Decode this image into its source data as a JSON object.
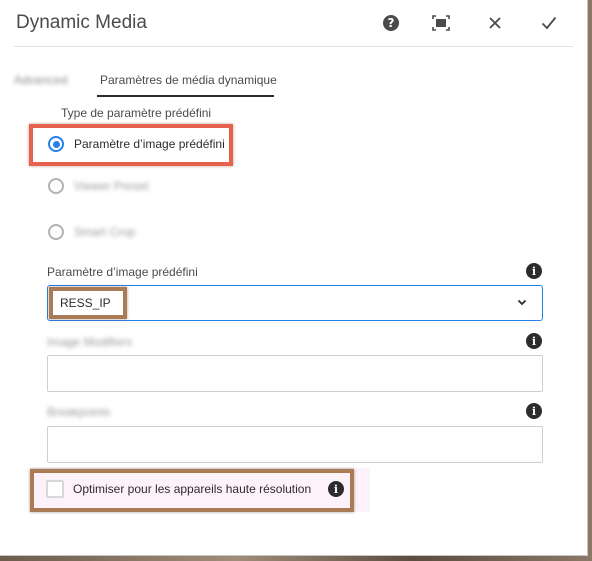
{
  "dialog": {
    "title": "Dynamic Media",
    "actions": {
      "help": "?",
      "fullscreen": "fullscreen",
      "close": "close",
      "done": "done"
    }
  },
  "tabs": [
    {
      "label": "Advanced",
      "active": false,
      "obscured": true
    },
    {
      "label": "Paramètres de média dynamique",
      "active": true
    }
  ],
  "preset_type": {
    "label": "Type de paramètre prédéfini",
    "options": [
      {
        "label": "Paramètre d’image prédéfini",
        "selected": true
      },
      {
        "label": "Viewer Preset",
        "selected": false,
        "obscured": true
      },
      {
        "label": "Smart Crop",
        "selected": false,
        "obscured": true
      }
    ]
  },
  "image_preset": {
    "label": "Paramètre d’image prédéfini",
    "value": "RESS_IP"
  },
  "image_modifiers": {
    "label": "Image Modifiers",
    "value": "",
    "obscured": true
  },
  "breakpoints": {
    "label": "Breakpoints",
    "value": "",
    "obscured": true
  },
  "hires_option": {
    "label": "Optimiser pour les appareils haute résolution",
    "checked": false
  },
  "icons": {
    "help": "help-icon",
    "fullscreen": "fullscreen-icon",
    "close": "close-icon",
    "done": "checkmark-icon",
    "info": "info-icon",
    "chevron": "chevron-down-icon"
  },
  "colors": {
    "accent": "#2680eb",
    "highlight_red": "#e8614f",
    "highlight_brown": "#a87a55"
  }
}
